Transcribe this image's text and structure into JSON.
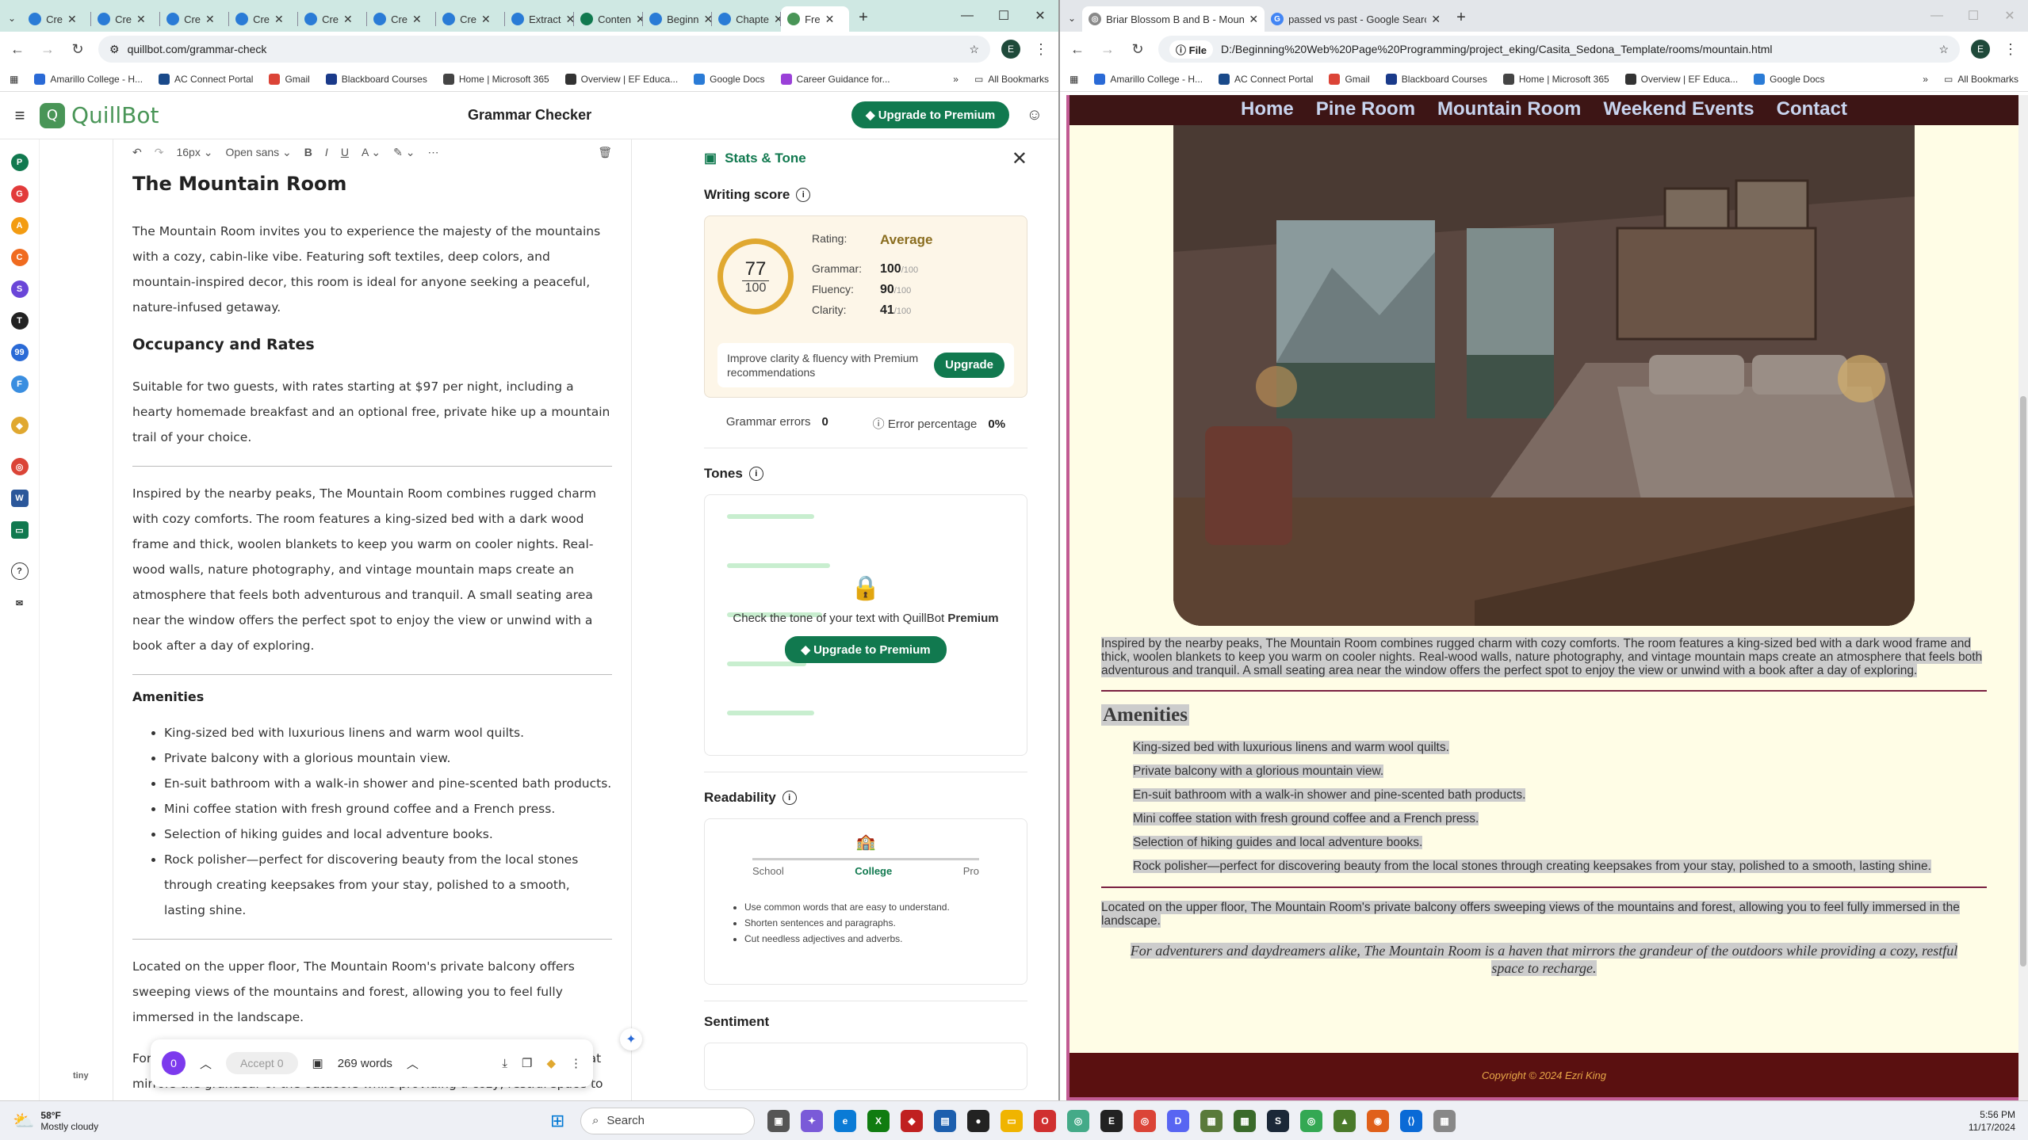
{
  "left_window": {
    "tabs": [
      {
        "label": "Cre",
        "color": "#2a7bd6"
      },
      {
        "label": "Cre",
        "color": "#2a7bd6"
      },
      {
        "label": "Cre",
        "color": "#2a7bd6"
      },
      {
        "label": "Cre",
        "color": "#2a7bd6"
      },
      {
        "label": "Cre",
        "color": "#2a7bd6"
      },
      {
        "label": "Cre",
        "color": "#2a7bd6"
      },
      {
        "label": "Cre",
        "color": "#2a7bd6"
      },
      {
        "label": "Extract",
        "color": "#2a7bd6"
      },
      {
        "label": "Conten",
        "color": "#11794f"
      },
      {
        "label": "Beginn",
        "color": "#2a7bd6"
      },
      {
        "label": "Chapte",
        "color": "#2a7bd6"
      },
      {
        "label": "Fre",
        "color": "#499557",
        "active": true
      }
    ],
    "url": "quillbot.com/grammar-check",
    "profile": "E",
    "bookmarks": [
      "Amarillo College - H...",
      "AC Connect Portal",
      "Gmail",
      "Blackboard Courses",
      "Home | Microsoft 365",
      "Overview | EF Educa...",
      "Google Docs",
      "Career Guidance for..."
    ],
    "all_bookmarks": "All Bookmarks"
  },
  "quillbot": {
    "logo": "QuillBot",
    "title": "Grammar Checker",
    "upgrade": "Upgrade to Premium",
    "toolbar": {
      "size": "16px",
      "font": "Open sans"
    },
    "doc": {
      "h1": "The Mountain Room",
      "p1": "The Mountain Room invites you to experience the majesty of the mountains with a cozy, cabin-like vibe. Featuring soft textiles, deep colors, and mountain-inspired decor, this room is ideal for anyone seeking a peaceful, nature-infused getaway.",
      "h2": "Occupancy and Rates",
      "p2": "Suitable for two guests, with rates starting at $97 per night, including a hearty homemade breakfast and an optional free, private hike up a mountain trail of your choice.",
      "p3": "Inspired by the nearby peaks, The Mountain Room combines rugged charm with cozy comforts. The room features a king-sized bed with a dark wood frame and thick, woolen blankets to keep you warm on cooler nights. Real-wood walls, nature photography, and vintage mountain maps create an atmosphere that feels both adventurous and tranquil. A small seating area near the window offers the perfect spot to enjoy the view or unwind with a book after a day of exploring.",
      "h3": "Amenities",
      "amenities": [
        "King-sized bed with luxurious linens and warm wool quilts.",
        "Private balcony with a glorious mountain view.",
        "En-suit bathroom with a walk-in shower and pine-scented bath products.",
        "Mini coffee station with fresh ground coffee and a French press.",
        "Selection of hiking guides and local adventure books.",
        "Rock polisher—perfect for discovering beauty from the local stones through creating keepsakes from your stay, polished to a smooth, lasting shine."
      ],
      "p4": "Located on the upper floor, The Mountain Room's private balcony offers sweeping views of the mountains and forest, allowing you to feel fully immersed in the landscape.",
      "p5": "For adventurers and daydreamers alike, The Mountain Room is a haven that mirrors the grandeur of the outdoors while providing a cozy, restful space to recharge."
    },
    "bottom": {
      "count": "0",
      "accept": "Accept 0",
      "words": "269 words"
    },
    "tiny": "tiny",
    "stats": {
      "title": "Stats & Tone",
      "writing_score": "Writing score",
      "score": "77",
      "score_max": "100",
      "rating_label": "Rating:",
      "rating": "Average",
      "grammar_label": "Grammar:",
      "grammar": "100",
      "fluency_label": "Fluency:",
      "fluency": "90",
      "clarity_label": "Clarity:",
      "clarity": "41",
      "out_of": "/100",
      "improve": "Improve clarity & fluency with Premium recommendations",
      "upgrade_btn": "Upgrade",
      "grammar_errors_label": "Grammar errors",
      "grammar_errors": "0",
      "error_pct_label": "Error percentage",
      "error_pct": "0%",
      "tones": "Tones",
      "tone_msg": "Check the tone of your text with QuillBot",
      "tone_premium": "Premium",
      "tone_upgrade": "Upgrade to Premium",
      "readability": "Readability",
      "scale": [
        "School",
        "College",
        "Pro"
      ],
      "tips": [
        "Use common words that are easy to understand.",
        "Shorten sentences and paragraphs.",
        "Cut needless adjectives and adverbs."
      ],
      "sentiment": "Sentiment"
    }
  },
  "right_window": {
    "tabs": [
      {
        "label": "Briar Blossom B and B - Mounta",
        "active": true
      },
      {
        "label": "passed vs past - Google Search"
      }
    ],
    "url_chip": "File",
    "url": "D:/Beginning%20Web%20Page%20Programming/project_eking/Casita_Sedona_Template/rooms/mountain.html",
    "profile": "E",
    "bookmarks": [
      "Amarillo College - H...",
      "AC Connect Portal",
      "Gmail",
      "Blackboard Courses",
      "Home | Microsoft 365",
      "Overview | EF Educa...",
      "Google Docs"
    ],
    "all_bookmarks": "All Bookmarks"
  },
  "site": {
    "nav": [
      "Home",
      "Pine Room",
      "Mountain Room",
      "Weekend Events",
      "Contact"
    ],
    "p1": "Inspired by the nearby peaks, The Mountain Room combines rugged charm with cozy comforts. The room features a king-sized bed with a dark wood frame and thick, woolen blankets to keep you warm on cooler nights. Real-wood walls, nature photography, and vintage mountain maps create an atmosphere that feels both adventurous and tranquil. A small seating area near the window offers the perfect spot to enjoy the view or unwind with a book after a day of exploring.",
    "amenities_title": "Amenities",
    "amenities": [
      "King-sized bed with luxurious linens and warm wool quilts.",
      "Private balcony with a glorious mountain view.",
      "En-suit bathroom with a walk-in shower and pine-scented bath products.",
      "Mini coffee station with fresh ground coffee and a French press.",
      "Selection of hiking guides and local adventure books.",
      "Rock polisher—perfect for discovering beauty from the local stones through creating keepsakes from your stay, polished to a smooth, lasting shine."
    ],
    "p2": "Located on the upper floor, The Mountain Room's private balcony offers sweeping views of the mountains and forest, allowing you to feel fully immersed in the landscape.",
    "p3": "For adventurers and daydreamers alike, The Mountain Room is a haven that mirrors the grandeur of the outdoors while providing a cozy, restful space to recharge.",
    "footer": "Copyright © 2024 Ezri King"
  },
  "taskbar": {
    "temp": "58°F",
    "weather": "Mostly cloudy",
    "search": "Search",
    "time": "5:56 PM",
    "date": "11/17/2024"
  }
}
